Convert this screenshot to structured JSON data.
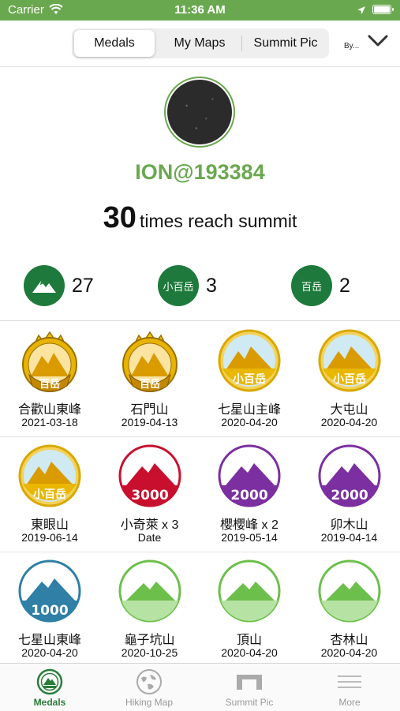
{
  "status_bar": {
    "carrier": "Carrier",
    "time": "11:36 AM"
  },
  "nav": {
    "segments": [
      "Medals",
      "My Maps",
      "Summit Pic"
    ],
    "active_segment": "Medals",
    "sort_label": "By..."
  },
  "profile": {
    "username": "ION@193384",
    "summit_count": "30",
    "summit_text": "times reach summit",
    "badges": [
      {
        "icon": "mountain-icon",
        "label": "",
        "count": "27"
      },
      {
        "icon": "xiao-baiyue-badge",
        "label": "小百岳",
        "count": "3"
      },
      {
        "icon": "baiyue-badge",
        "label": "百岳",
        "count": "2"
      }
    ]
  },
  "medals": [
    {
      "name": "合歡山東峰",
      "date": "2021-03-18",
      "type": "crown",
      "badge_text": "百岳"
    },
    {
      "name": "石門山",
      "date": "2019-04-13",
      "type": "crown",
      "badge_text": "百岳"
    },
    {
      "name": "七星山主峰",
      "date": "2020-04-20",
      "type": "gold",
      "badge_text": "小百岳"
    },
    {
      "name": "大屯山",
      "date": "2020-04-20",
      "type": "gold",
      "badge_text": "小百岳"
    },
    {
      "name": "東眼山",
      "date": "2019-06-14",
      "type": "gold",
      "badge_text": "小百岳"
    },
    {
      "name": "小奇萊 x 3",
      "date": "Date",
      "type": "red",
      "badge_text": "3000"
    },
    {
      "name": "櫻櫻峰 x 2",
      "date": "2019-05-14",
      "type": "purple",
      "badge_text": "2000"
    },
    {
      "name": "卯木山",
      "date": "2019-04-14",
      "type": "purple",
      "badge_text": "2000"
    },
    {
      "name": "七星山東峰",
      "date": "2020-04-20",
      "type": "blue",
      "badge_text": "1000"
    },
    {
      "name": "龜子坑山",
      "date": "2020-10-25",
      "type": "green",
      "badge_text": ""
    },
    {
      "name": "頂山",
      "date": "2020-04-20",
      "type": "green",
      "badge_text": ""
    },
    {
      "name": "杏林山",
      "date": "2020-04-20",
      "type": "green",
      "badge_text": ""
    }
  ],
  "tabs": [
    {
      "label": "Medals",
      "icon": "medal-icon",
      "active": true
    },
    {
      "label": "Hiking Map",
      "icon": "globe-icon",
      "active": false
    },
    {
      "label": "Summit Pic",
      "icon": "summit-frame-icon",
      "active": false
    },
    {
      "label": "More",
      "icon": "menu-lines-icon",
      "active": false
    }
  ],
  "colors": {
    "brand_green": "#6aa84f",
    "badge_green": "#1e7a3c",
    "tab_active": "#2a7d3a",
    "medal_red": "#c8102e",
    "medal_purple": "#7b2fa0",
    "medal_blue": "#2f7fa6",
    "medal_gold": "#e0b010"
  }
}
